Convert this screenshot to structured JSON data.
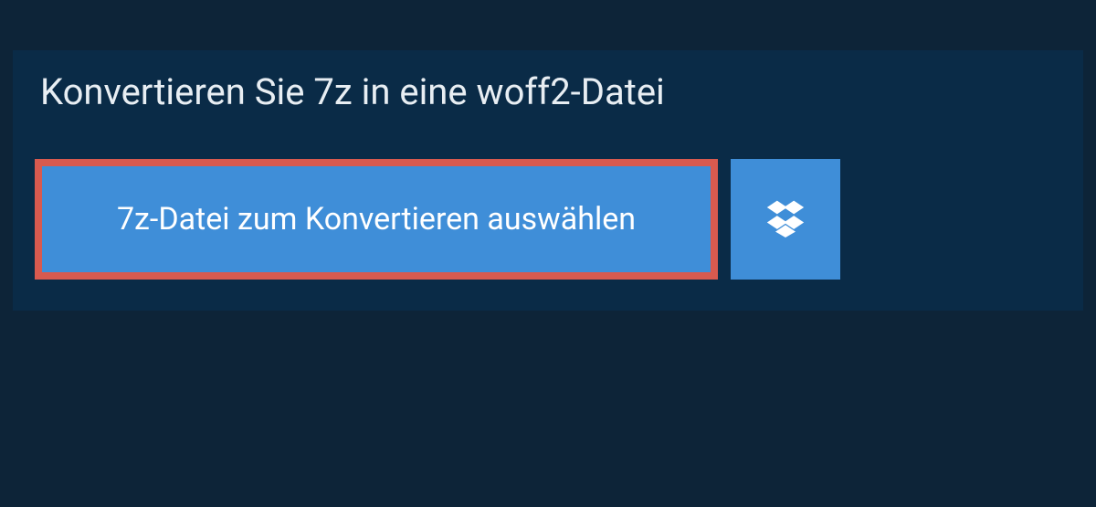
{
  "heading": "Konvertieren Sie 7z in eine woff2-Datei",
  "buttons": {
    "select_file_label": "7z-Datei zum Konvertieren auswählen"
  },
  "icons": {
    "dropbox": "dropbox-icon"
  },
  "colors": {
    "page_bg": "#0d2438",
    "panel_bg": "#0a2b47",
    "button_bg": "#3f8ed8",
    "highlight_border": "#d85a4f",
    "text_light": "#e8eef3",
    "text_white": "#ffffff"
  }
}
